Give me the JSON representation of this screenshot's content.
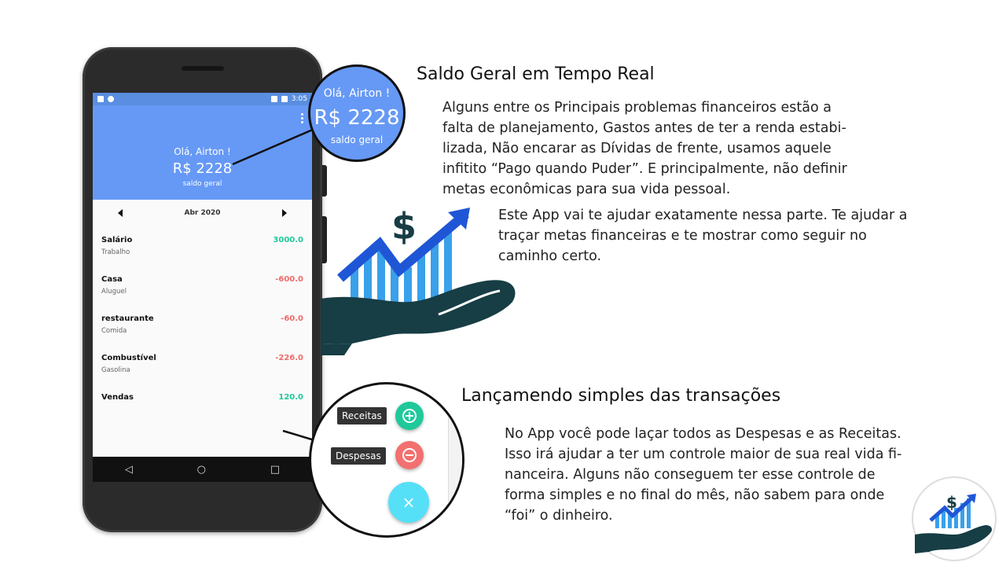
{
  "phone": {
    "status_time": "3:05",
    "header": {
      "greeting": "Olá, Airton !",
      "balance": "R$ 2228",
      "balance_label": "saldo geral"
    },
    "month": "Abr 2020",
    "transactions": [
      {
        "name": "Salário",
        "category": "Trabalho",
        "value": "3000.0",
        "color": "#1fc99a"
      },
      {
        "name": "Casa",
        "category": "Aluguel",
        "value": "-600.0",
        "color": "#f06a6a"
      },
      {
        "name": "restaurante",
        "category": "Comida",
        "value": "-60.0",
        "color": "#f06a6a"
      },
      {
        "name": "Combustível",
        "category": "Gasolina",
        "value": "-226.0",
        "color": "#f06a6a"
      },
      {
        "name": "Vendas",
        "category": "",
        "value": "120.0",
        "color": "#1fc99a"
      }
    ],
    "fab_icon": "+",
    "nav": {
      "back": "◁",
      "home": "○",
      "recents": "□"
    }
  },
  "zoom_top": {
    "greeting": "Olá, Airton !",
    "balance": "R$ 2228",
    "balance_label": "saldo geral"
  },
  "zoom_bottom": {
    "income_label": "Receitas",
    "expense_label": "Despesas",
    "income_icon": "plus-circle-icon",
    "expense_icon": "minus-circle-icon",
    "close_icon": "×",
    "income_color": "#1fc99a",
    "expense_color": "#f27070"
  },
  "section1": {
    "title": "Saldo Geral em Tempo Real",
    "para1": [
      "Alguns entre os Principais problemas financeiros estão a",
      "falta de planejamento, Gastos antes de ter a renda estabi-",
      "lizada, Não encarar as Dívidas de frente, usamos aquele",
      "infitito “Pago quando Puder”. E principalmente, não definir",
      "metas econômicas para sua vida pessoal."
    ],
    "para2": [
      "Este App vai te ajudar exatamente nessa parte. Te ajudar a",
      "traçar metas financeiras e te mostrar como seguir no",
      "caminho certo."
    ]
  },
  "section2": {
    "title": "Lançamendo simples das transações",
    "para": [
      "No App você pode laçar todos as Despesas e as Receitas.",
      "Isso irá ajudar a ter um controle maior de sua real vida fi-",
      "nanceira. Alguns não conseguem ter esse controle de",
      "forma simples e no final do mês, não sabem para onde",
      "“foi” o dinheiro."
    ]
  },
  "colors": {
    "header_blue": "#6699f5",
    "accent_cyan": "#55e0f8",
    "hand_dark": "#173d45",
    "chart_blue": "#1f56d6"
  }
}
